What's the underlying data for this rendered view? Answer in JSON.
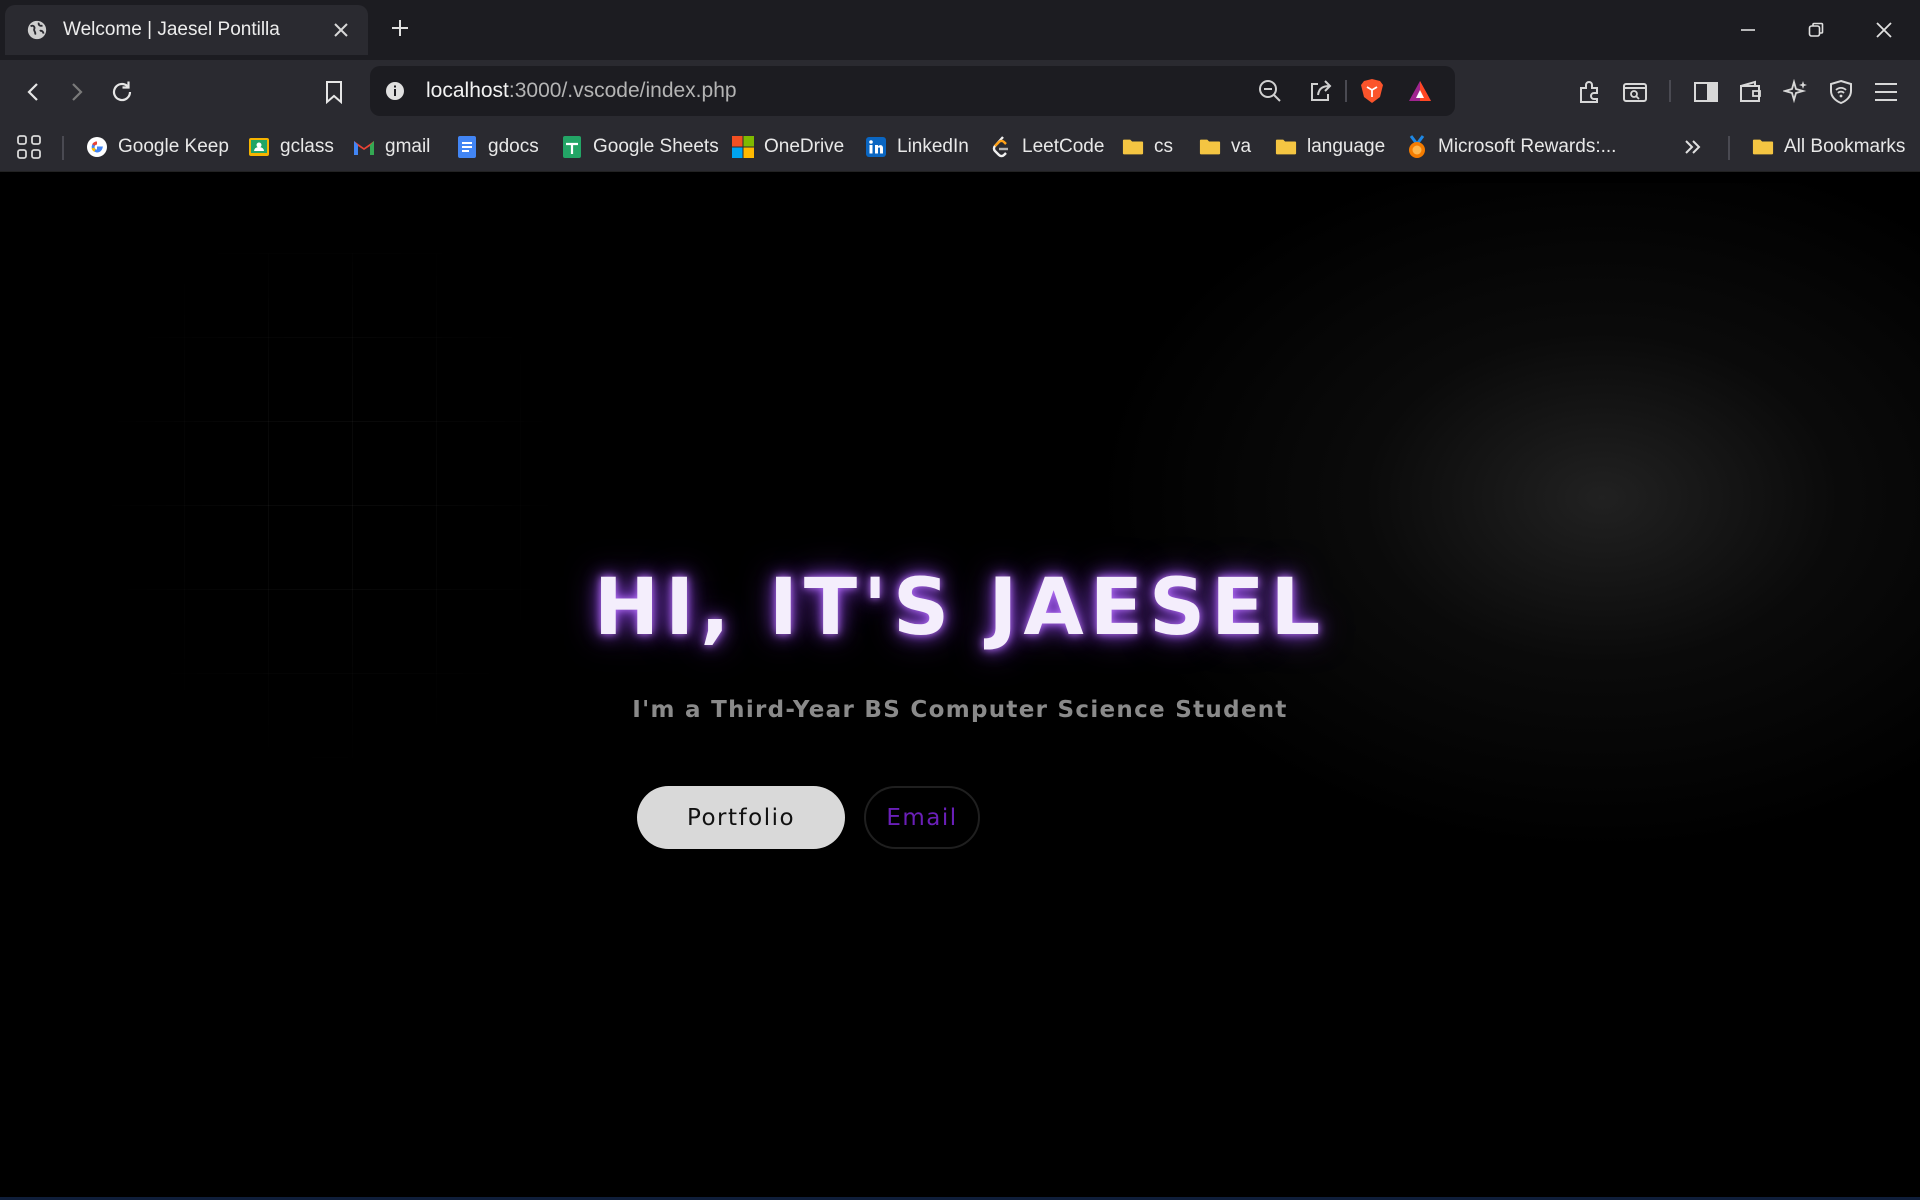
{
  "browser": {
    "tab": {
      "title": "Welcome | Jaesel Pontilla",
      "favicon": "globe-icon"
    },
    "address": {
      "host": "localhost",
      "path": ":3000/.vscode/index.php"
    },
    "bookmarks": [
      {
        "label": "Google Keep",
        "icon": "google-icon"
      },
      {
        "label": "gclass",
        "icon": "classroom-icon"
      },
      {
        "label": "gmail",
        "icon": "gmail-icon"
      },
      {
        "label": "gdocs",
        "icon": "docs-icon"
      },
      {
        "label": "Google Sheets",
        "icon": "sheets-icon"
      },
      {
        "label": "OneDrive",
        "icon": "microsoft-icon"
      },
      {
        "label": "LinkedIn",
        "icon": "linkedin-icon"
      },
      {
        "label": "LeetCode",
        "icon": "leetcode-icon"
      },
      {
        "label": "cs",
        "icon": "folder-icon"
      },
      {
        "label": "va",
        "icon": "folder-icon"
      },
      {
        "label": "language",
        "icon": "folder-icon"
      },
      {
        "label": "Microsoft Rewards:...",
        "icon": "rewards-icon"
      }
    ],
    "all_bookmarks": "All Bookmarks"
  },
  "page": {
    "title": "HI, IT'S JAESEL",
    "subtitle": "I'm a Third-Year BS Computer Science Student",
    "buttons": {
      "portfolio": "Portfolio",
      "email": "Email"
    }
  },
  "colors": {
    "accent_glow": "#a050ff",
    "email_text": "#6a1fb8",
    "background": "#000000"
  }
}
